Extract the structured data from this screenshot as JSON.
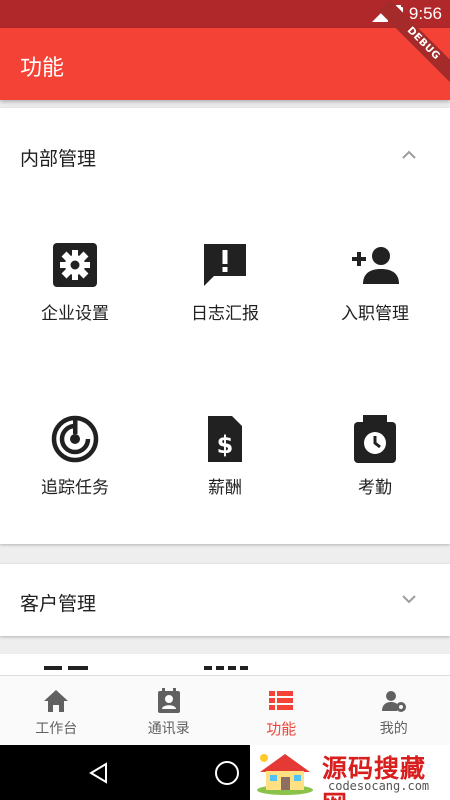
{
  "status_bar": {
    "time": "9:56",
    "signal_icon": "signal-icon",
    "battery_icon": "battery-charging-icon"
  },
  "debug_banner": "DEBUG",
  "app_bar": {
    "title": "功能"
  },
  "sections": {
    "internal": {
      "title": "内部管理",
      "expanded": true,
      "chevron_icon": "chevron-up-icon",
      "items": [
        {
          "label": "企业设置",
          "icon": "settings-icon"
        },
        {
          "label": "日志汇报",
          "icon": "feedback-icon"
        },
        {
          "label": "入职管理",
          "icon": "person-add-icon"
        },
        {
          "label": "追踪任务",
          "icon": "radar-track-icon"
        },
        {
          "label": "薪酬",
          "icon": "salary-document-icon"
        },
        {
          "label": "考勤",
          "icon": "attendance-clock-icon"
        }
      ]
    },
    "customer": {
      "title": "客户管理",
      "expanded": false,
      "chevron_icon": "chevron-down-icon"
    }
  },
  "bottom_nav": {
    "items": [
      {
        "label": "工作台",
        "icon": "home-icon",
        "active": false
      },
      {
        "label": "通讯录",
        "icon": "contacts-icon",
        "active": false
      },
      {
        "label": "功能",
        "icon": "view-list-icon",
        "active": true
      },
      {
        "label": "我的",
        "icon": "user-settings-icon",
        "active": false
      }
    ]
  },
  "system_nav": {
    "back_icon": "back-triangle-icon",
    "home_icon": "home-circle-icon"
  },
  "watermark": {
    "title": "源码搜藏网",
    "url": "codesocang.com"
  },
  "colors": {
    "primary": "#f44336",
    "status_bar": "#b0282a",
    "active_nav": "#f44336",
    "icon": "#212121"
  }
}
